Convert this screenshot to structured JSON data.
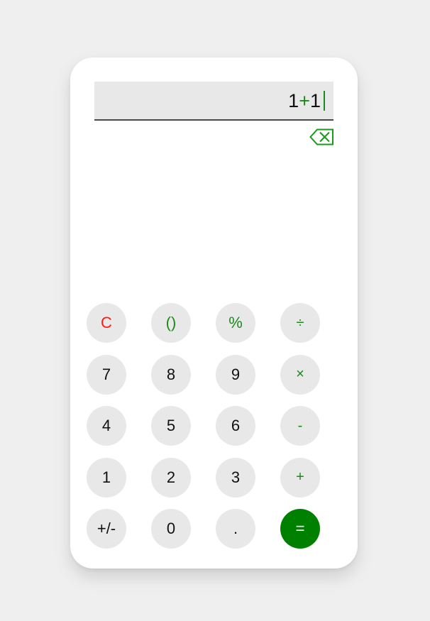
{
  "display": {
    "expression_parts": [
      "1",
      "+",
      "1"
    ]
  },
  "icons": {
    "backspace": "backspace-icon"
  },
  "colors": {
    "accent": "#008000",
    "operator_text": "#1a8a1a",
    "clear_text": "#ff1a1a",
    "key_background": "#e8e8e8"
  },
  "keys": {
    "clear": "C",
    "parentheses": "()",
    "percent": "%",
    "divide": "÷",
    "seven": "7",
    "eight": "8",
    "nine": "9",
    "multiply": "×",
    "four": "4",
    "five": "5",
    "six": "6",
    "subtract": "-",
    "one": "1",
    "two": "2",
    "three": "3",
    "add": "+",
    "negate": "+/-",
    "zero": "0",
    "decimal": ".",
    "equals": "="
  }
}
